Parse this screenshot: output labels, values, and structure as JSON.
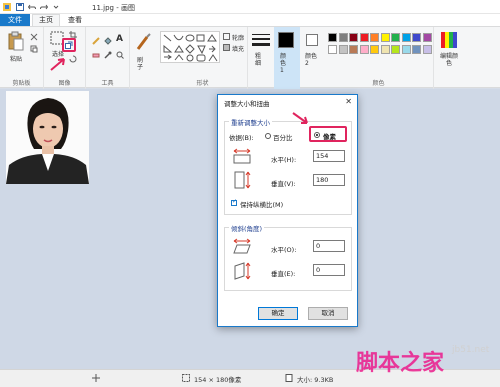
{
  "window": {
    "title": "11.jpg - 画图"
  },
  "tabs": {
    "file": "文件",
    "home": "主页",
    "view": "查看"
  },
  "ribbon": {
    "clipboard": {
      "paste": "粘贴",
      "group": "剪贴板"
    },
    "image": {
      "select": "选择",
      "group": "图像"
    },
    "tools": {
      "group": "工具"
    },
    "brushes": {
      "label": "刷子"
    },
    "shapes": {
      "outline": "轮廓",
      "fill": "填充",
      "group": "形状"
    },
    "size": {
      "label": "粗细"
    },
    "color1": {
      "label": "颜色 1"
    },
    "color2": {
      "label": "颜色 2"
    },
    "colors": {
      "group": "颜色",
      "edit": "编辑颜色"
    },
    "palette_row1": [
      "#000000",
      "#7f7f7f",
      "#880015",
      "#ed1c24",
      "#ff7f27",
      "#fff200",
      "#22b14c",
      "#00a2e8",
      "#3f48cc",
      "#a349a4"
    ],
    "palette_row2": [
      "#ffffff",
      "#c3c3c3",
      "#b97a57",
      "#ffaec9",
      "#ffc90e",
      "#efe4b0",
      "#b5e61d",
      "#99d9ea",
      "#7092be",
      "#c8bfe7"
    ]
  },
  "dialog": {
    "title": "调整大小和扭曲",
    "resize_section": "重新调整大小",
    "by_label": "依据(B):",
    "percent": "百分比",
    "pixels": "像素",
    "horizontal_label": "水平(H):",
    "horizontal_value": "154",
    "vertical_label": "垂直(V):",
    "vertical_value": "180",
    "keep_aspect": "保持纵横比(M)",
    "skew_section": "倾斜(角度)",
    "skew_h_label": "水平(O):",
    "skew_h_value": "0",
    "skew_v_label": "垂直(E):",
    "skew_v_value": "0",
    "ok": "确定",
    "cancel": "取消"
  },
  "status": {
    "dimensions": "154 × 180像素",
    "size": "大小: 9.3KB"
  },
  "watermark": {
    "text": "脚本之家",
    "site": "jb51.net"
  }
}
